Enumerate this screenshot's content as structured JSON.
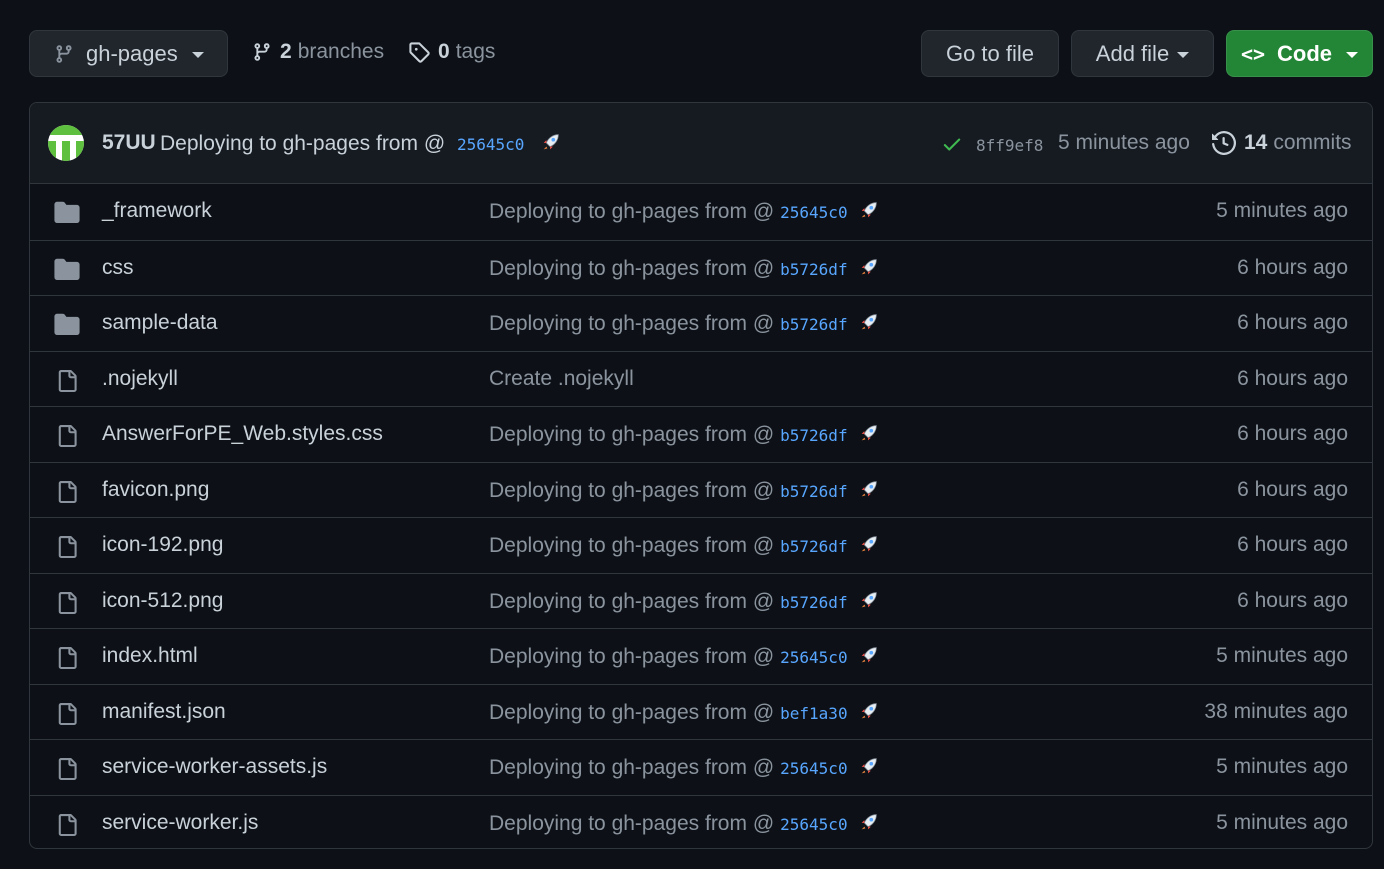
{
  "toolbar": {
    "branch_button_label": "gh-pages",
    "branches_count": "2",
    "branches_label": "branches",
    "tags_count": "0",
    "tags_label": "tags",
    "go_to_file_label": "Go to file",
    "add_file_label": "Add file",
    "code_label": "Code",
    "code_icon": "<>"
  },
  "latest_commit": {
    "author": "57UU",
    "message": "Deploying to gh-pages from @",
    "source_sha": "25645c0",
    "status_icon": "check-icon",
    "sha": "8ff9ef8",
    "age": "5 minutes ago",
    "commits_count": "14",
    "commits_label": "commits"
  },
  "files": [
    {
      "type": "folder",
      "name": "_framework",
      "message": "Deploying to gh-pages from @",
      "sha": "25645c0",
      "age": "5 minutes ago"
    },
    {
      "type": "folder",
      "name": "css",
      "message": "Deploying to gh-pages from @",
      "sha": "b5726df",
      "age": "6 hours ago"
    },
    {
      "type": "folder",
      "name": "sample-data",
      "message": "Deploying to gh-pages from @",
      "sha": "b5726df",
      "age": "6 hours ago"
    },
    {
      "type": "file",
      "name": ".nojekyll",
      "message": "Create .nojekyll",
      "sha": "",
      "age": "6 hours ago"
    },
    {
      "type": "file",
      "name": "AnswerForPE_Web.styles.css",
      "message": "Deploying to gh-pages from @",
      "sha": "b5726df",
      "age": "6 hours ago"
    },
    {
      "type": "file",
      "name": "favicon.png",
      "message": "Deploying to gh-pages from @",
      "sha": "b5726df",
      "age": "6 hours ago"
    },
    {
      "type": "file",
      "name": "icon-192.png",
      "message": "Deploying to gh-pages from @",
      "sha": "b5726df",
      "age": "6 hours ago"
    },
    {
      "type": "file",
      "name": "icon-512.png",
      "message": "Deploying to gh-pages from @",
      "sha": "b5726df",
      "age": "6 hours ago"
    },
    {
      "type": "file",
      "name": "index.html",
      "message": "Deploying to gh-pages from @",
      "sha": "25645c0",
      "age": "5 minutes ago"
    },
    {
      "type": "file",
      "name": "manifest.json",
      "message": "Deploying to gh-pages from @",
      "sha": "bef1a30",
      "age": "38 minutes ago"
    },
    {
      "type": "file",
      "name": "service-worker-assets.js",
      "message": "Deploying to gh-pages from @",
      "sha": "25645c0",
      "age": "5 minutes ago"
    },
    {
      "type": "file",
      "name": "service-worker.js",
      "message": "Deploying to gh-pages from @",
      "sha": "25645c0",
      "age": "5 minutes ago"
    }
  ],
  "colors": {
    "background": "#0d1117",
    "panel": "#161b22",
    "border": "#30363d",
    "link": "#58a6ff",
    "muted": "#8b949e",
    "code_button": "#238636",
    "success": "#3fb950"
  }
}
